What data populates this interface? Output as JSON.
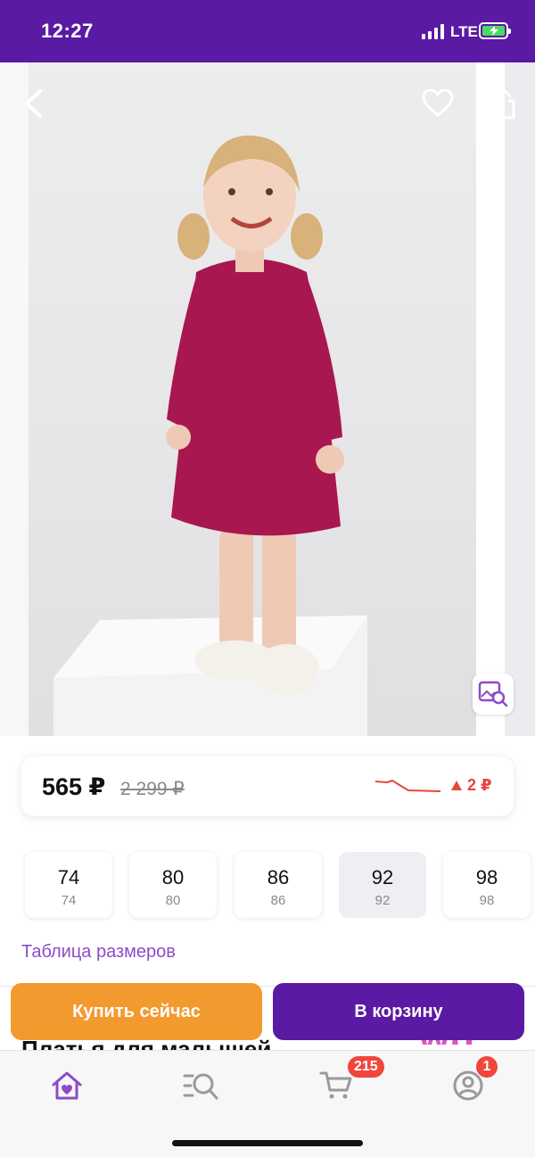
{
  "status_bar": {
    "time": "12:27",
    "network": "LTE",
    "battery_charging": true
  },
  "product_image": {
    "icons": [
      "back-arrow-icon",
      "heart-icon",
      "share-icon",
      "image-search-icon"
    ]
  },
  "price": {
    "current": "565 ₽",
    "old": "2 299 ₽",
    "change": "2 ₽",
    "change_direction": "up",
    "change_color": "#e5473d"
  },
  "sizes": [
    {
      "label": "74",
      "sub": "74",
      "selected": false
    },
    {
      "label": "80",
      "sub": "80",
      "selected": false
    },
    {
      "label": "86",
      "sub": "86",
      "selected": false
    },
    {
      "label": "92",
      "sub": "92",
      "selected": true
    },
    {
      "label": "98",
      "sub": "98",
      "selected": false
    }
  ],
  "size_chart_link": "Таблица размеров",
  "partial_title": "Платья для малышей",
  "actions": {
    "buy_now": "Купить сейчас",
    "add_to_cart": "В корзину"
  },
  "tab_bar": {
    "items": [
      "home-icon",
      "catalog-search-icon",
      "cart-icon",
      "profile-icon"
    ],
    "cart_badge": "215",
    "profile_badge": "1",
    "active_color": "#8b4cc9"
  },
  "colors": {
    "brand_purple": "#5a1aa3",
    "buy_orange": "#f39a2e",
    "link_purple": "#8b4cc9",
    "badge_red": "#f0463c"
  }
}
